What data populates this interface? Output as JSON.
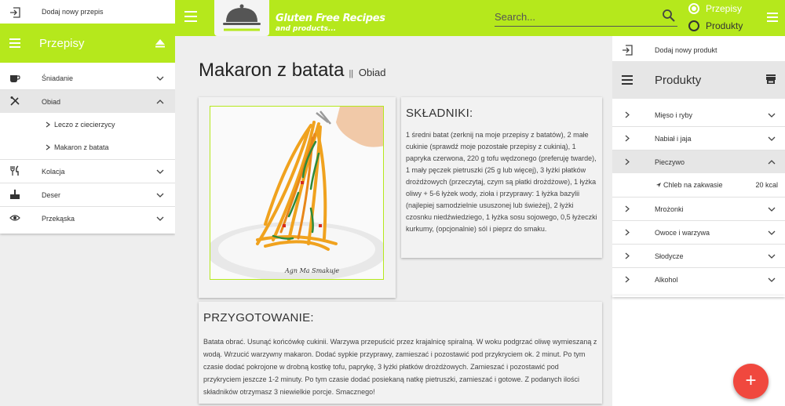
{
  "topbar": {
    "logo_title": "Gluten Free Recipes",
    "logo_subtitle": "and products...",
    "search_placeholder": "Search...",
    "radio_options": [
      {
        "label": "Przepisy",
        "checked": true
      },
      {
        "label": "Produkty",
        "checked": false
      }
    ],
    "accent_color": "#b5e81c",
    "icons": [
      "menu-icon",
      "search-icon",
      "menu-icon"
    ]
  },
  "left_sidebar": {
    "add_label": "Dodaj nowy przepis",
    "header": "Przepisy",
    "items": [
      {
        "label": "Śniadanie",
        "icon": "coffee-icon",
        "expanded": false
      },
      {
        "label": "Obiad",
        "icon": "fork-knife-icon",
        "expanded": true,
        "selected": true
      },
      {
        "label": "Kolacja",
        "icon": "cutlery-icon",
        "expanded": false
      },
      {
        "label": "Deser",
        "icon": "cake-icon",
        "expanded": false
      },
      {
        "label": "Przekąska",
        "icon": "eye-icon",
        "expanded": false
      }
    ],
    "subitems": [
      {
        "label": "Leczo z ciecierzycy"
      },
      {
        "label": "Makaron z batata"
      }
    ]
  },
  "recipe": {
    "title": "Makaron z batata",
    "separator": "||",
    "category": "Obiad",
    "ingredients_header": "SKŁADNIKI:",
    "ingredients": "1 średni batat (zerknij na moje przepisy z batatów), 2 małe cukinie (sprawdź moje pozostałe przepisy z cukinią), 1 papryka czerwona, 220 g tofu wędzonego (preferuję twarde), 1 mały pęczek pietruszki (25 g lub więcej), 3 łyżki płatków drożdżowych (przeczytaj, czym są płatki drożdżowe), 1 łyżka oliwy + 5-6 łyżek wody, zioła i przyprawy: 1 łyżka bazylii (najlepiej samodzielnie ususzonej lub świeżej), 2 łyżki czosnku niedźwiedziego, 1 łyżka sosu sojowego, 0,5 łyżeczki kurkumy, (opcjonalnie) sól i pieprz do smaku.",
    "preparation_header": "PRZYGOTOWANIE:",
    "preparation": "Batata obrać. Usunąć końcówkę cukinii. Warzywa przepuścić przez krajalnicę spiralną. W woku podgrzać oliwę wymieszaną z wodą. Wrzucić warzywny makaron. Dodać sypkie przyprawy, zamieszać i pozostawić pod przykryciem ok. 2 minut. Po tym czasie dodać pokrojone w drobną kostkę tofu, paprykę, 3 łyżki płatków drożdżowych. Zamieszać i pozostawić pod przykryciem jeszcze 1-2 minuty. Po tym czasie dodać posiekaną natkę pietruszki, zamieszać i gotowe. Z podanych ilości składników otrzymasz 3 niewielkie porcje. Smacznego!"
  },
  "right_sidebar": {
    "add_label": "Dodaj nowy produkt",
    "header": "Produkty",
    "items": [
      {
        "label": "Mięso i ryby"
      },
      {
        "label": "Nabiał i jaja"
      },
      {
        "label": "Pieczywo",
        "expanded": true,
        "selected": true
      },
      {
        "label": "Mrożonki"
      },
      {
        "label": "Owoce i warzywa"
      },
      {
        "label": "Słodycze"
      },
      {
        "label": "Alkohol"
      }
    ],
    "subitem": {
      "label": "Chleb na zakwasie",
      "kcal": "20 kcal"
    }
  },
  "fab": {
    "label": "+",
    "color": "#f0483e"
  }
}
